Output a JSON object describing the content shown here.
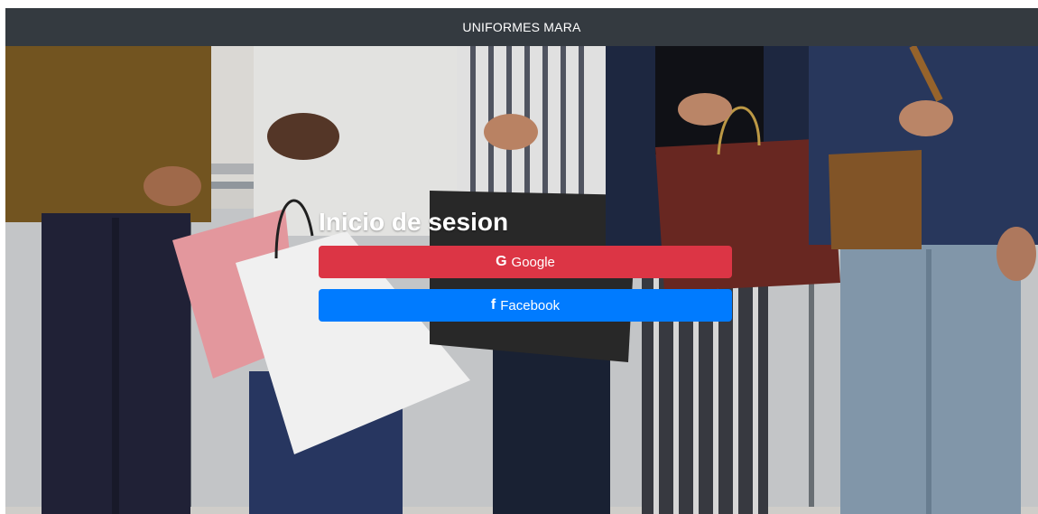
{
  "navbar": {
    "brand": "UNIFORMES MARA"
  },
  "login": {
    "title": "Inicio de sesion",
    "google_label": "Google",
    "google_icon": "G",
    "facebook_label": "Facebook",
    "facebook_icon": "f"
  },
  "colors": {
    "navbar": "#343a40",
    "google_button": "#dc3545",
    "facebook_button": "#007bff"
  },
  "hero": {
    "image": "people-with-shopping-bags-photo"
  }
}
